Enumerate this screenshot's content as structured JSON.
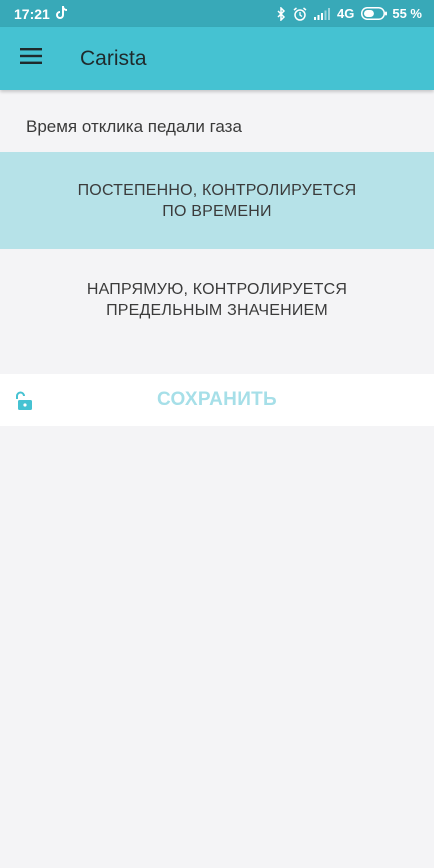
{
  "status_bar": {
    "time": "17:21",
    "left_icons": [
      "tiktok-icon"
    ],
    "right_icons": [
      "bluetooth-icon",
      "alarm-icon",
      "signal-icon"
    ],
    "network": "4G",
    "battery_percent_text": "55 %",
    "battery_level": 0.55
  },
  "app_bar": {
    "title": "Carista",
    "menu_icon": "hamburger-menu-icon",
    "background": "#45c2d2"
  },
  "setting": {
    "title": "Время отклика педали газа",
    "options": [
      {
        "label": "ПОСТЕПЕННО, КОНТРОЛИРУЕТСЯ\nПО ВРЕМЕНИ",
        "selected": true
      },
      {
        "label": "НАПРЯМУЮ, КОНТРОЛИРУЕТСЯ\nПРЕДЕЛЬНЫМ ЗНАЧЕНИЕМ",
        "selected": false
      }
    ],
    "selected_color": "#b6e2e8"
  },
  "save_bar": {
    "lock_icon": "unlock-icon",
    "save_label": "СОХРАНИТЬ",
    "save_color": "#a6dfe8"
  }
}
